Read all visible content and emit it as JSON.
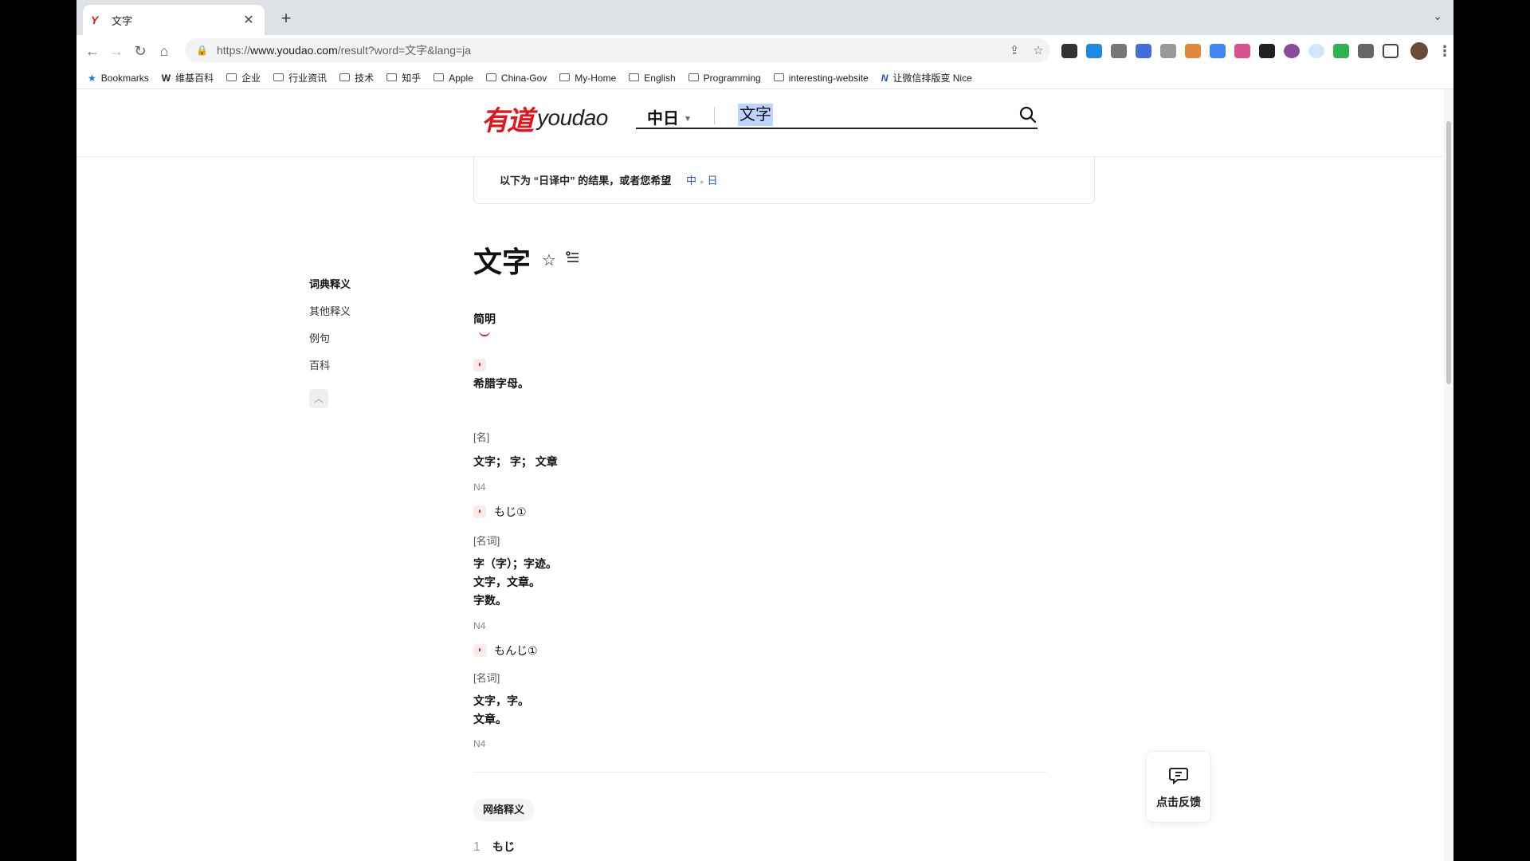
{
  "browser": {
    "tab_title": "文字",
    "tab_favicon": "Y",
    "url_prefix": "https://",
    "url_host": "www.youdao.com",
    "url_path": "/result?word=文字&lang=ja"
  },
  "bookmarks": [
    {
      "label": "Bookmarks",
      "icon": "star-icon"
    },
    {
      "label": "维基百科",
      "icon": "wiki-icon"
    },
    {
      "label": "企业",
      "icon": "folder-icon"
    },
    {
      "label": "行业资讯",
      "icon": "folder-icon"
    },
    {
      "label": "技术",
      "icon": "folder-icon"
    },
    {
      "label": "知乎",
      "icon": "folder-icon"
    },
    {
      "label": "Apple",
      "icon": "folder-icon"
    },
    {
      "label": "China-Gov",
      "icon": "folder-icon"
    },
    {
      "label": "My-Home",
      "icon": "folder-icon"
    },
    {
      "label": "English",
      "icon": "folder-icon"
    },
    {
      "label": "Programming",
      "icon": "folder-icon"
    },
    {
      "label": "interesting-website",
      "icon": "folder-icon"
    },
    {
      "label": "让微信排版变 Nice",
      "icon": "nice-icon"
    }
  ],
  "site": {
    "logo_cn": "有道",
    "logo_en": "youdao",
    "lang_select": "中日",
    "search_value": "文字",
    "brand_color": "#e0161c"
  },
  "suggest": {
    "text": "以下为 “日译中” 的结果，或者您希望",
    "link_zh": "中",
    "link_ja": "日"
  },
  "side_nav": [
    "词典释义",
    "其他释义",
    "例句",
    "百科"
  ],
  "entry": {
    "word": "文字",
    "section_title": "简明",
    "greek_def": "希腊字母。",
    "blocks": [
      {
        "pos": "[名]",
        "def": [
          "文字； 字； 文章"
        ],
        "level": "N4"
      },
      {
        "reading": "もじ①",
        "pos": "[名词]",
        "def": [
          "字（字）；字迹。",
          "文字，文章。",
          "字数。"
        ],
        "level": "N4"
      },
      {
        "reading": "もんじ①",
        "pos": "[名词]",
        "def": [
          "文字，字。",
          "文章。"
        ],
        "level": "N4"
      }
    ]
  },
  "net": {
    "tab_label": "网络释义",
    "first_num": "1",
    "first_kana": "もじ"
  },
  "feedback": {
    "label": "点击反馈"
  }
}
